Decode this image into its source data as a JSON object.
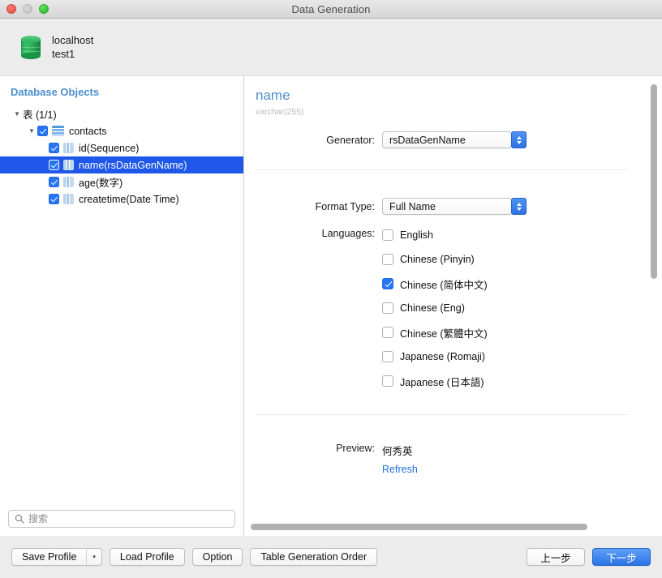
{
  "window": {
    "title": "Data Generation",
    "traffic_lights": [
      "close-red",
      "minimize-disabled",
      "zoom-green"
    ]
  },
  "connection": {
    "host": "localhost",
    "database": "test1",
    "icon": "database-cylinder-icon"
  },
  "sidebar": {
    "title": "Database Objects",
    "root": {
      "label": "表 (1/1)",
      "expanded": true
    },
    "table": {
      "label": "contacts",
      "checked": true,
      "expanded": true,
      "icon": "table-icon"
    },
    "columns": [
      {
        "label": "id(Sequence)",
        "checked": true,
        "selected": false,
        "icon": "column-icon"
      },
      {
        "label": "name(rsDataGenName)",
        "checked": true,
        "selected": true,
        "icon": "column-icon"
      },
      {
        "label": "age(数字)",
        "checked": true,
        "selected": false,
        "icon": "column-icon"
      },
      {
        "label": "createtime(Date Time)",
        "checked": true,
        "selected": false,
        "icon": "column-icon"
      }
    ],
    "search": {
      "placeholder": "搜索",
      "value": "",
      "icon": "search-icon"
    }
  },
  "detail": {
    "field_name": "name",
    "field_type": "varchar(255)",
    "generator": {
      "label": "Generator:",
      "value": "rsDataGenName"
    },
    "format_type": {
      "label": "Format Type:",
      "value": "Full Name"
    },
    "languages": {
      "label": "Languages:",
      "options": [
        {
          "label": "English",
          "checked": false
        },
        {
          "label": "Chinese (Pinyin)",
          "checked": false
        },
        {
          "label": "Chinese (简体中文)",
          "checked": true
        },
        {
          "label": "Chinese (Eng)",
          "checked": false
        },
        {
          "label": "Chinese (繁體中文)",
          "checked": false
        },
        {
          "label": "Japanese (Romaji)",
          "checked": false
        },
        {
          "label": "Japanese (日本語)",
          "checked": false
        }
      ]
    },
    "preview": {
      "label": "Preview:",
      "value": "何秀英",
      "refresh_label": "Refresh"
    }
  },
  "footer": {
    "save_profile": "Save Profile",
    "save_profile_arrow": "▾",
    "load_profile": "Load Profile",
    "option": "Option",
    "table_generation_order": "Table Generation Order",
    "previous": "上一步",
    "next": "下一步"
  },
  "colors": {
    "accent_blue": "#4d8fce",
    "selection_blue": "#1f57e8",
    "primary_button": "#2a73e6",
    "link_blue": "#1f6fdd",
    "db_green": "#2bb05c"
  }
}
